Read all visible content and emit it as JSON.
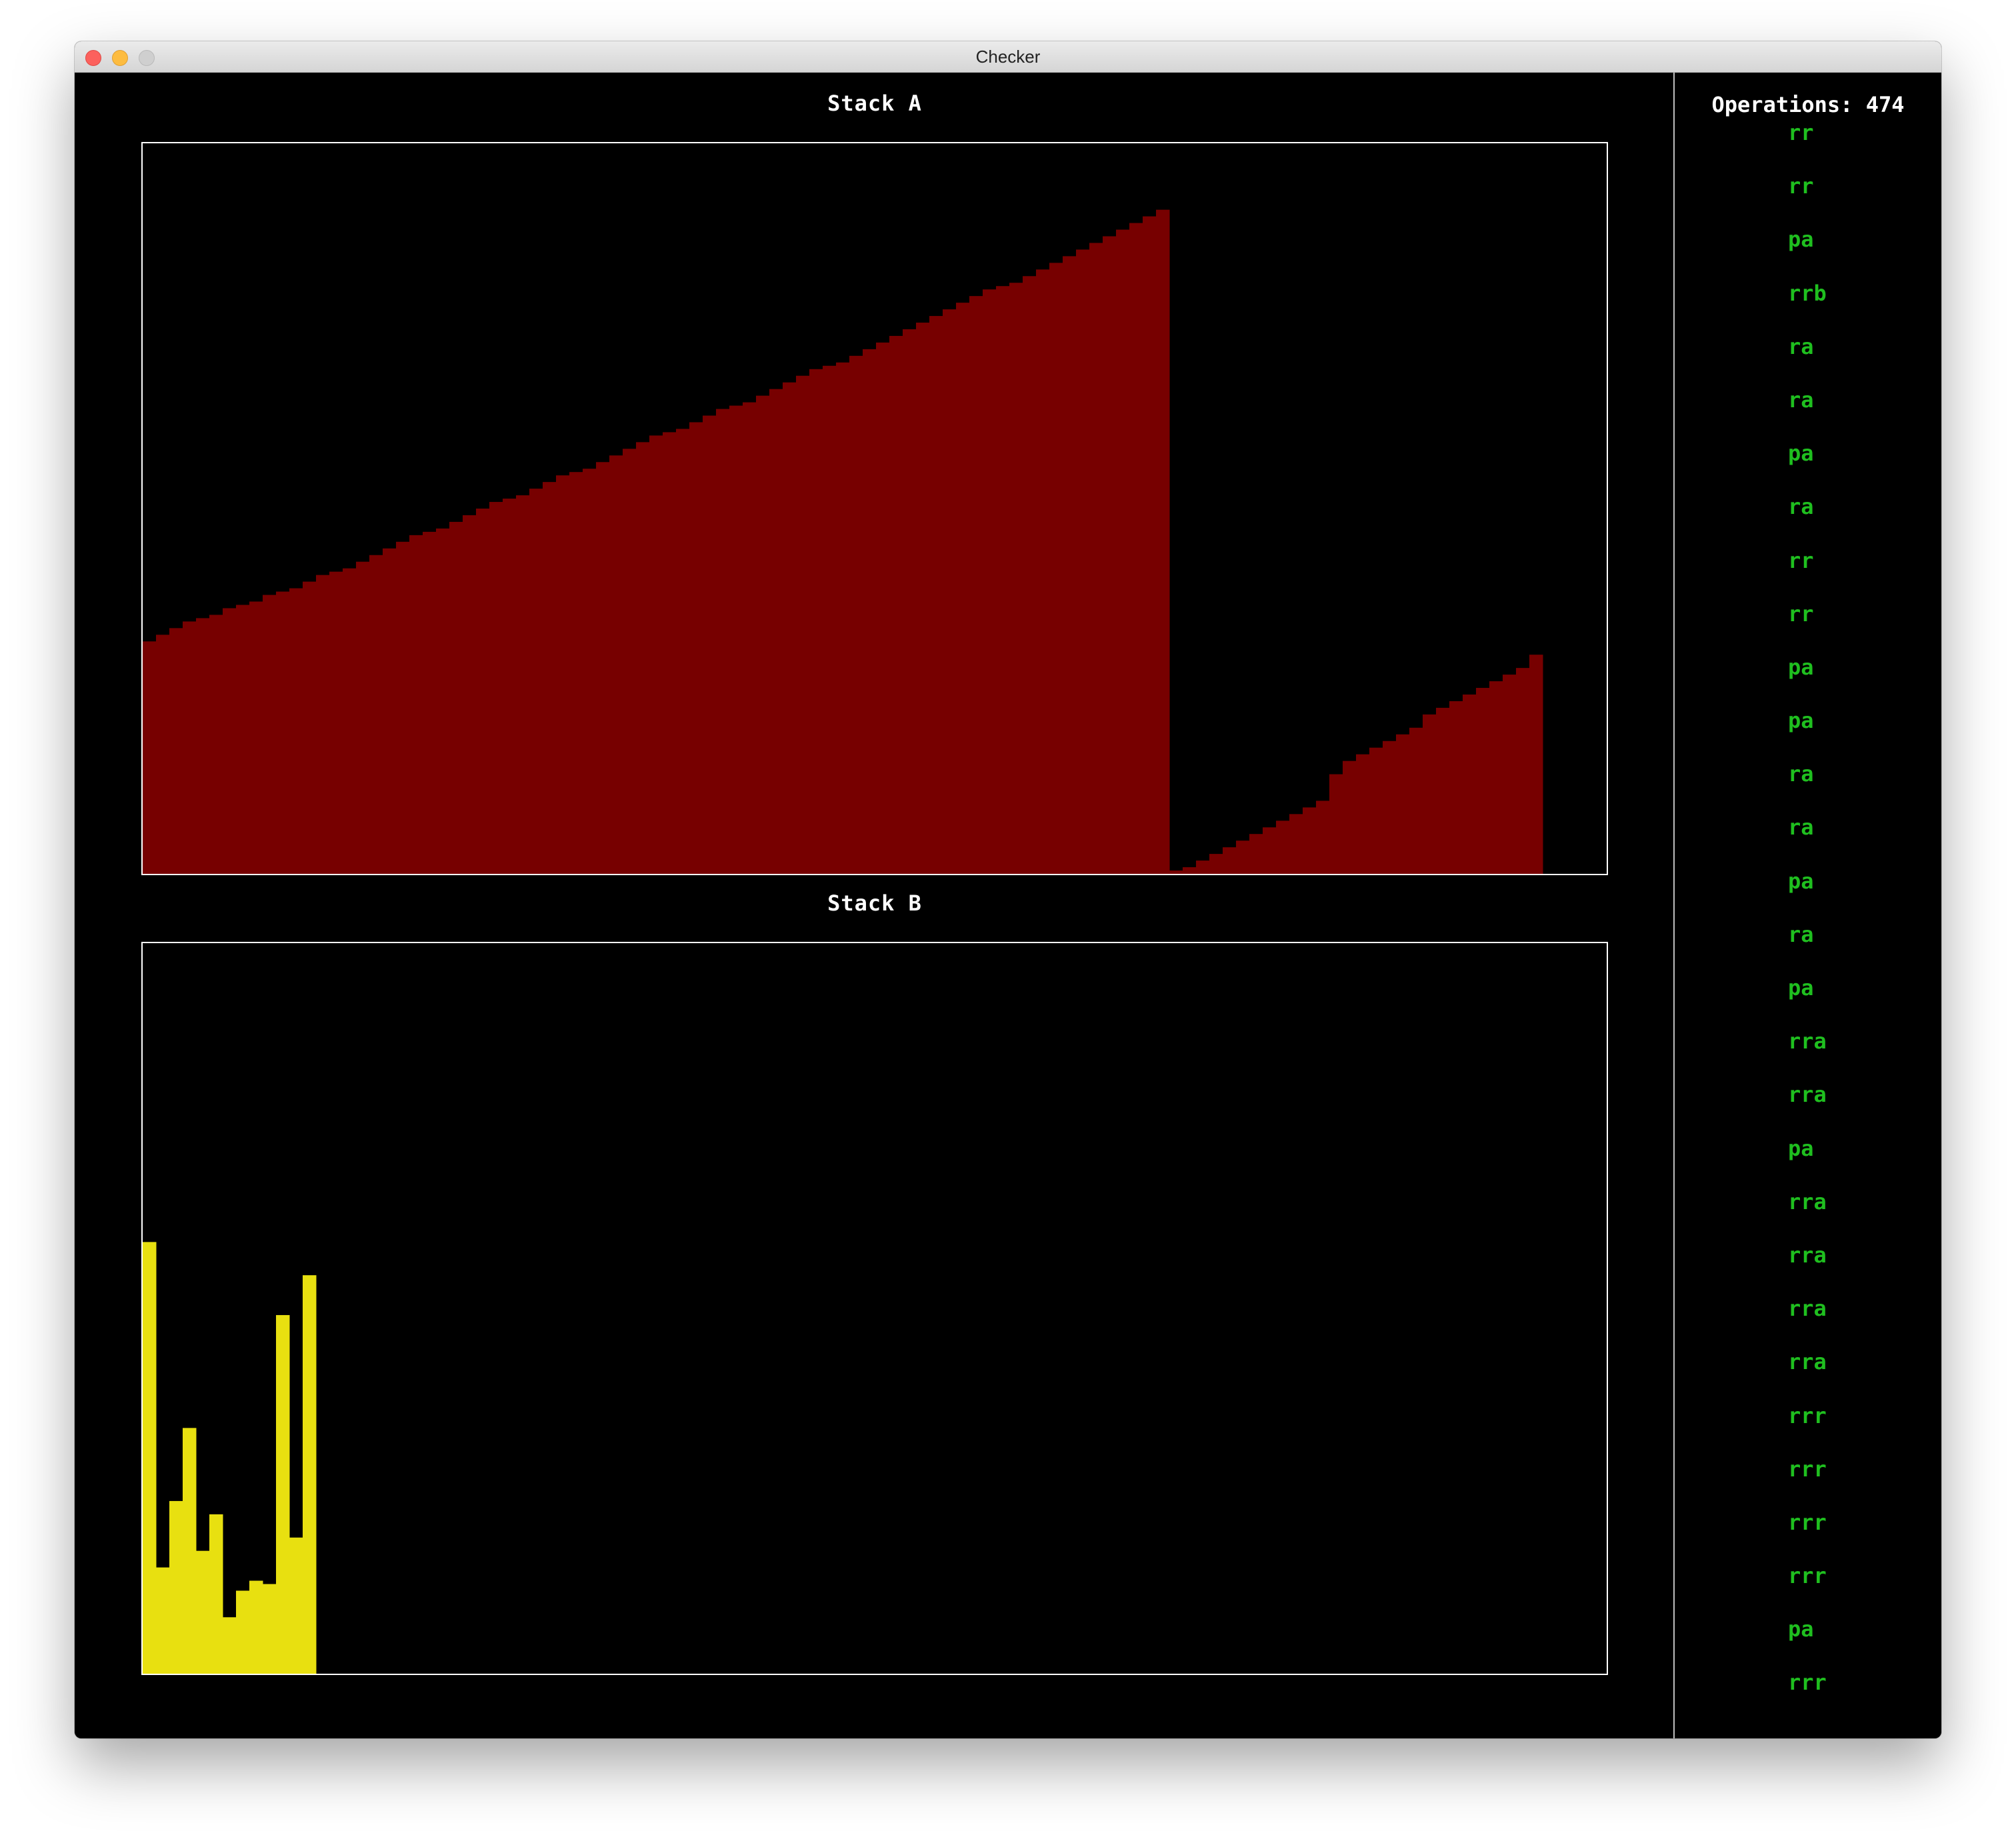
{
  "window": {
    "title": "Checker"
  },
  "stack_a": {
    "label": "Stack A",
    "bar_color": "#770000"
  },
  "stack_b": {
    "label": "Stack B",
    "bar_color": "#e8e010"
  },
  "operations": {
    "label": "Operations:",
    "count": "474",
    "text_color": "#1fbf1f",
    "items": [
      "rr",
      "rr",
      "pa",
      "rrb",
      "ra",
      "ra",
      "pa",
      "ra",
      "rr",
      "rr",
      "pa",
      "pa",
      "ra",
      "ra",
      "pa",
      "ra",
      "pa",
      "rra",
      "rra",
      "pa",
      "rra",
      "rra",
      "rra",
      "rra",
      "rrr",
      "rrr",
      "rrr",
      "rrr",
      "pa",
      "rrr"
    ]
  },
  "chart_data": [
    {
      "type": "bar",
      "title": "Stack A",
      "ylim": [
        0,
        110
      ],
      "values": [
        35,
        36,
        37,
        38,
        38.5,
        39,
        40,
        40.5,
        41,
        42,
        42.5,
        43,
        44,
        45,
        45.5,
        46,
        47,
        48,
        49,
        50,
        51,
        51.5,
        52,
        53,
        54,
        55,
        56,
        56.5,
        57,
        58,
        59,
        60,
        60.5,
        61,
        62,
        63,
        64,
        65,
        66,
        66.5,
        67,
        68,
        69,
        70,
        70.5,
        71,
        72,
        73,
        74,
        75,
        76,
        76.5,
        77,
        78,
        79,
        80,
        81,
        82,
        83,
        84,
        85,
        86,
        87,
        88,
        88.5,
        89,
        90,
        91,
        92,
        93,
        94,
        95,
        96,
        97,
        98,
        99,
        100,
        0.5,
        1,
        2,
        3,
        4,
        5,
        6,
        7,
        8,
        9,
        10,
        11,
        15,
        17,
        18,
        19,
        20,
        21,
        22,
        24,
        25,
        26,
        27,
        28,
        29,
        30,
        31,
        33
      ]
    },
    {
      "type": "bar",
      "title": "Stack B",
      "ylim": [
        0,
        110
      ],
      "values": [
        65,
        16,
        26,
        37,
        18.5,
        24,
        8.5,
        12.5,
        14,
        13.5,
        54,
        20.5,
        60
      ]
    }
  ]
}
